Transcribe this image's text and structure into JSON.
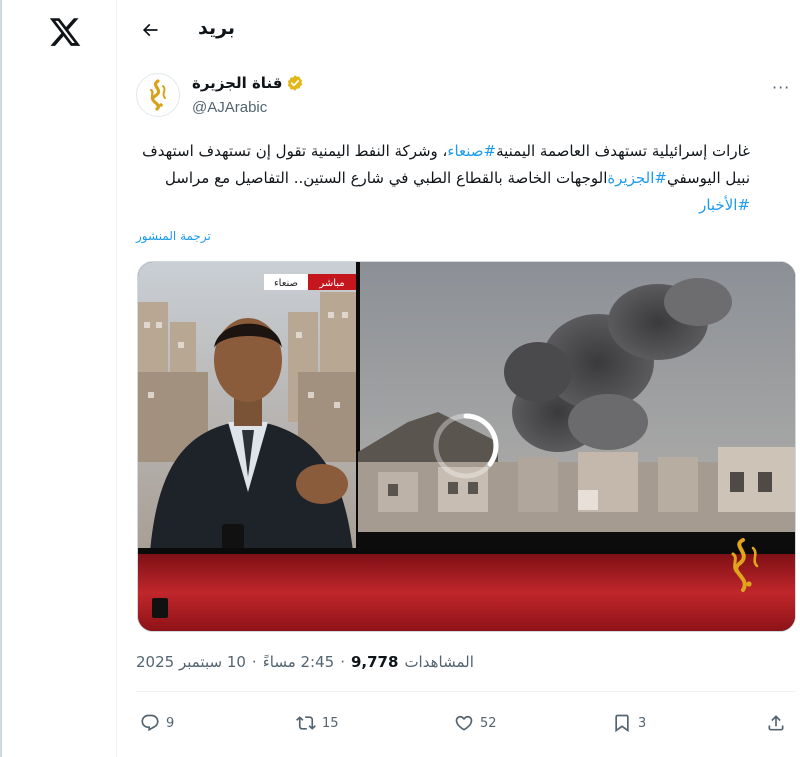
{
  "nav": {
    "back_icon": "arrow-left-icon",
    "title": "بريد",
    "logo_icon": "x-logo-icon"
  },
  "author": {
    "display_name": "قناة الجزيرة",
    "handle": "@AJArabic",
    "verified_color": "#e2b719",
    "avatar_icon": "al-jazeera-logo"
  },
  "tweet": {
    "line1_pre": "، وشركة النفط اليمنية تقول إن تستهدف استهدف",
    "hashtag1": "#صنعاء",
    "line1_post": "غارات إسرائيلية تستهدف العاصمة اليمنية",
    "line2_pre": "نبيل اليوسفي",
    "hashtag2": "#الجزيرة",
    "line2_post": "الوجهات الخاصة بالقطاع الطبي في شارع الستين.. التفاصيل مع مراسل",
    "hashtag3": "#الأخبار",
    "translate_label": "ترجمة المنشور"
  },
  "media": {
    "live_badge": "مباشر",
    "location_badge": "صنعاء",
    "loading_icon": "spinner-icon"
  },
  "meta": {
    "views_label": "المشاهدات",
    "views_count": "9,778",
    "time": "2:45 مساءً",
    "separator": "·",
    "date": "10 سبتمبر 2025"
  },
  "actions": {
    "reply_count": "9",
    "repost_count": "15",
    "like_count": "52",
    "bookmark_count": "3"
  },
  "colors": {
    "accent": "#1d9bf0",
    "muted": "#536471",
    "text": "#0f1419"
  }
}
